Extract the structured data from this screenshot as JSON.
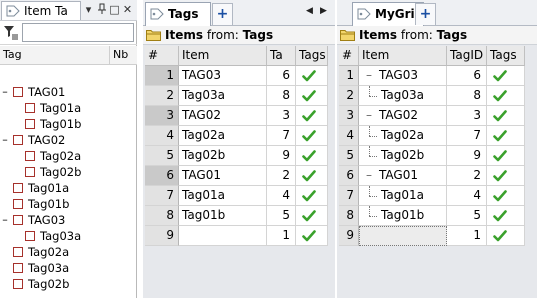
{
  "left_panel": {
    "tab_title": "Item Ta",
    "pin_glyph": "▾",
    "pushpin_glyph": "⊕",
    "restore_glyph": "□",
    "close_glyph": "✕",
    "filter_value": "",
    "columns": [
      "Tag",
      "Nb"
    ],
    "tree": [
      {
        "label": "TAG01",
        "level": 0,
        "expanded": true
      },
      {
        "label": "Tag01a",
        "level": 1
      },
      {
        "label": "Tag01b",
        "level": 1
      },
      {
        "label": "TAG02",
        "level": 0,
        "expanded": true
      },
      {
        "label": "Tag02a",
        "level": 1
      },
      {
        "label": "Tag02b",
        "level": 1
      },
      {
        "label": "Tag01a",
        "level": 0
      },
      {
        "label": "Tag01b",
        "level": 0
      },
      {
        "label": "TAG03",
        "level": 0,
        "expanded": true
      },
      {
        "label": "Tag03a",
        "level": 1
      },
      {
        "label": "Tag02a",
        "level": 0
      },
      {
        "label": "Tag03a",
        "level": 0
      },
      {
        "label": "Tag02b",
        "level": 0
      }
    ]
  },
  "tags_grid": {
    "tab_title": "Tags",
    "add_tab_glyph": "+",
    "nav_left": "◀",
    "nav_right": "▶",
    "items_label": "Items",
    "items_from": "from:",
    "items_source": "Tags",
    "columns": [
      "#",
      "Item",
      "Ta",
      "Tags"
    ],
    "rows": [
      {
        "num": "1",
        "item": "TAG03",
        "id": "6",
        "check": true,
        "tree": "sel"
      },
      {
        "num": "2",
        "item": "Tag03a",
        "id": "8",
        "check": true
      },
      {
        "num": "3",
        "item": "TAG02",
        "id": "3",
        "check": true,
        "tree": "sel"
      },
      {
        "num": "4",
        "item": "Tag02a",
        "id": "7",
        "check": true
      },
      {
        "num": "5",
        "item": "Tag02b",
        "id": "9",
        "check": true
      },
      {
        "num": "6",
        "item": "TAG01",
        "id": "2",
        "check": true,
        "tree": "sel"
      },
      {
        "num": "7",
        "item": "Tag01a",
        "id": "4",
        "check": true
      },
      {
        "num": "8",
        "item": "Tag01b",
        "id": "5",
        "check": true
      },
      {
        "num": "9",
        "item": "",
        "id": "1",
        "check": true
      }
    ]
  },
  "mygrid": {
    "tab_title": "MyGrid",
    "add_tab_glyph": "+",
    "items_label": "Items",
    "items_from": "from:",
    "items_source": "Tags",
    "columns": [
      "#",
      "Item",
      "TagID",
      "Tags"
    ],
    "rows": [
      {
        "num": "1",
        "item": "TAG03",
        "id": "6",
        "check": true,
        "parent": true
      },
      {
        "num": "2",
        "item": "Tag03a",
        "id": "8",
        "check": true
      },
      {
        "num": "3",
        "item": "TAG02",
        "id": "3",
        "check": true,
        "parent": true
      },
      {
        "num": "4",
        "item": "Tag02a",
        "id": "7",
        "check": true
      },
      {
        "num": "5",
        "item": "Tag02b",
        "id": "9",
        "check": true
      },
      {
        "num": "6",
        "item": "TAG01",
        "id": "2",
        "check": true,
        "parent": true
      },
      {
        "num": "7",
        "item": "Tag01a",
        "id": "4",
        "check": true
      },
      {
        "num": "8",
        "item": "Tag01b",
        "id": "5",
        "check": true
      },
      {
        "num": "9",
        "item": "",
        "id": "1",
        "check": true
      }
    ]
  },
  "colors": {
    "check_green": "#3aa12c",
    "checkbox_border": "#a6312b",
    "tab_accent": "#1a4fa3"
  }
}
